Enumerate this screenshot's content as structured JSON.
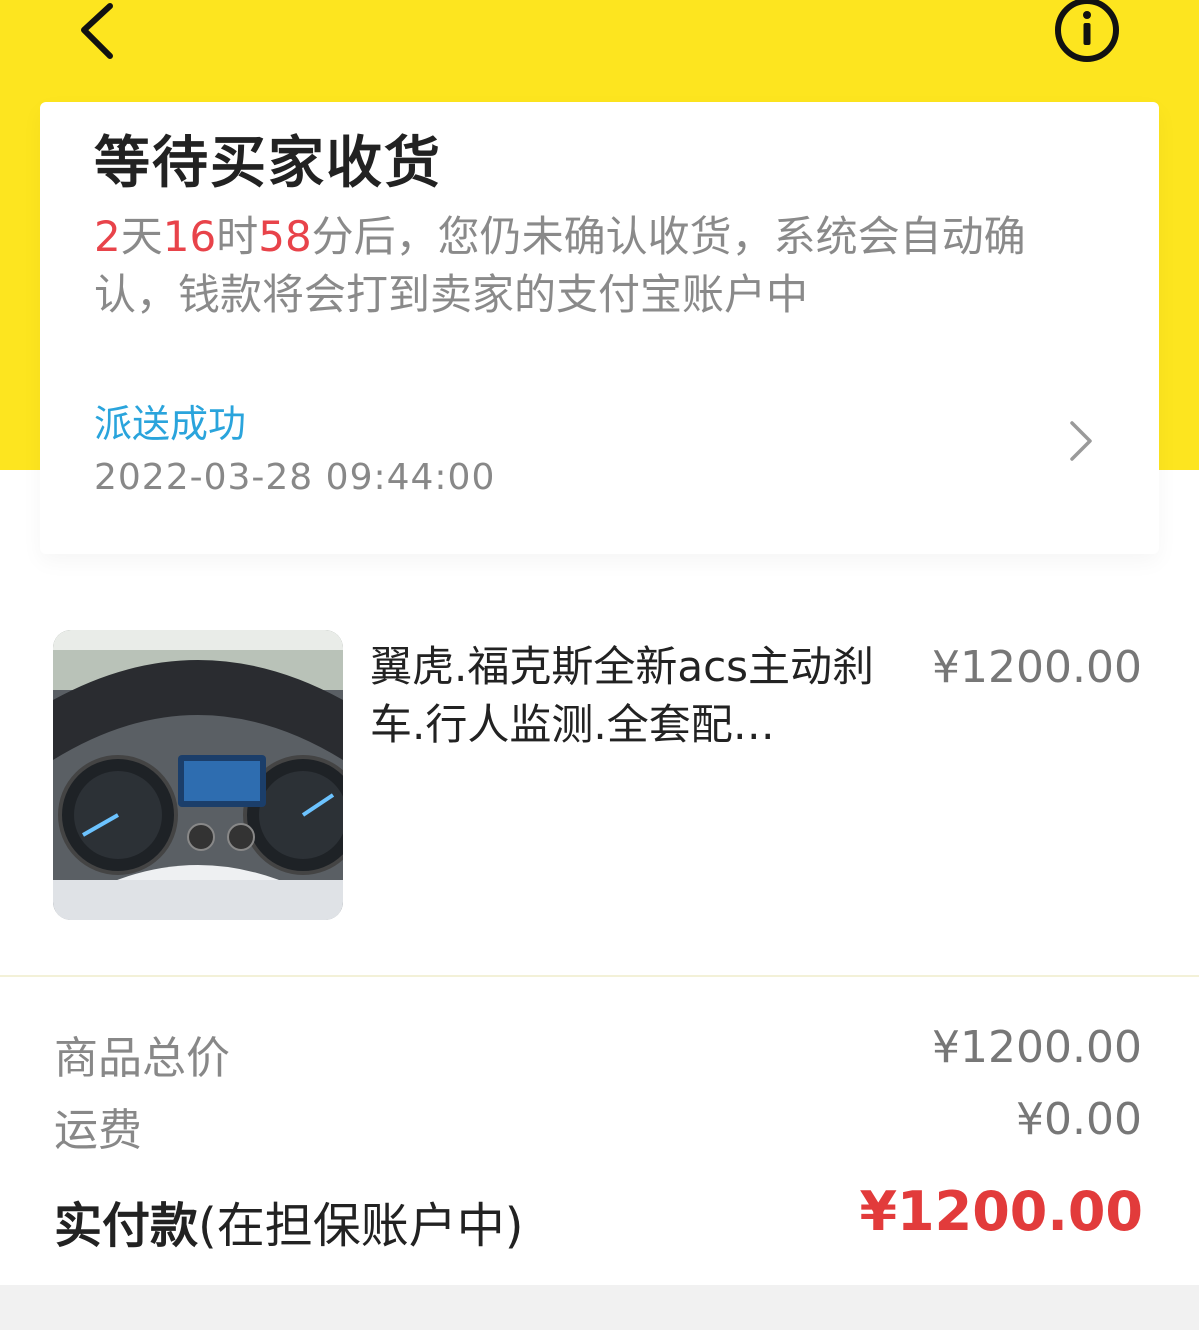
{
  "header": {
    "back_icon": "chevron-left-icon",
    "info_icon": "info-icon",
    "background_color": "#fde51f"
  },
  "status": {
    "title": "等待买家收货",
    "countdown_days": "2",
    "unit_days": "天",
    "countdown_hours": "16",
    "unit_hours": "时",
    "countdown_minutes": "58",
    "desc_rest": "分后，您仍未确认收货，系统会自动确认，钱款将会打到卖家的支付宝账户中",
    "highlight_color": "#e8434a"
  },
  "logistics": {
    "status": "派送成功",
    "time": "2022-03-28 09:44:00",
    "status_color": "#2aa4dc",
    "chevron_icon": "chevron-right-icon"
  },
  "product": {
    "name": "翼虎.福克斯全新acs主动刹车.行人监测.全套配…",
    "price": "¥1200.00",
    "image": "car-dashboard-photo"
  },
  "summary": {
    "items_total_label": "商品总价",
    "items_total_value": "¥1200.00",
    "shipping_label": "运费",
    "shipping_value": "¥0.00",
    "paid_label": "实付款",
    "paid_note": "(在担保账户中)",
    "paid_value": "¥1200.00",
    "paid_color": "#e23b3b"
  }
}
